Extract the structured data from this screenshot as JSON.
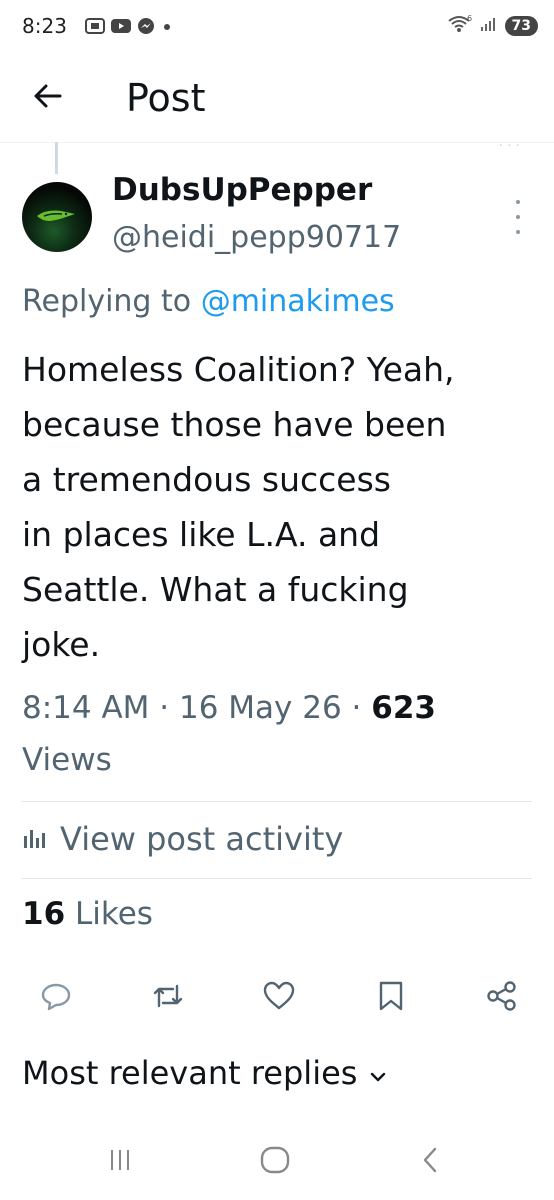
{
  "status_bar": {
    "time": "8:23",
    "battery": "73",
    "wifi_label": "6"
  },
  "header": {
    "title": "Post"
  },
  "post": {
    "author_name": "DubsUpPepper",
    "author_handle": "@heidi_pepp90717",
    "replying_prefix": "Replying to",
    "replying_mention": "@minakimes",
    "body": "Homeless Coalition? Yeah,\nbecause those have been\na tremendous success\nin places like L.A. and\nSeattle. What a fucking\njoke.",
    "time": "8:14 AM",
    "date": "16 May 26",
    "views_count": "623",
    "views_label": "Views",
    "activity_label": "View post activity",
    "likes_count": "16",
    "likes_label": "Likes"
  },
  "replies": {
    "sort_label": "Most relevant replies"
  },
  "colors": {
    "accent": "#1d9bf0",
    "text_primary": "#0f1419",
    "text_secondary": "#536471",
    "divider": "#e1e8ed"
  },
  "icons": {
    "back": "arrow-left-icon",
    "more": "more-vertical-icon",
    "activity": "bar-chart-icon",
    "reply": "speech-bubble-icon",
    "repost": "repost-icon",
    "like": "heart-icon",
    "bookmark": "bookmark-icon",
    "share": "share-icon",
    "chevron": "chevron-down-icon"
  }
}
